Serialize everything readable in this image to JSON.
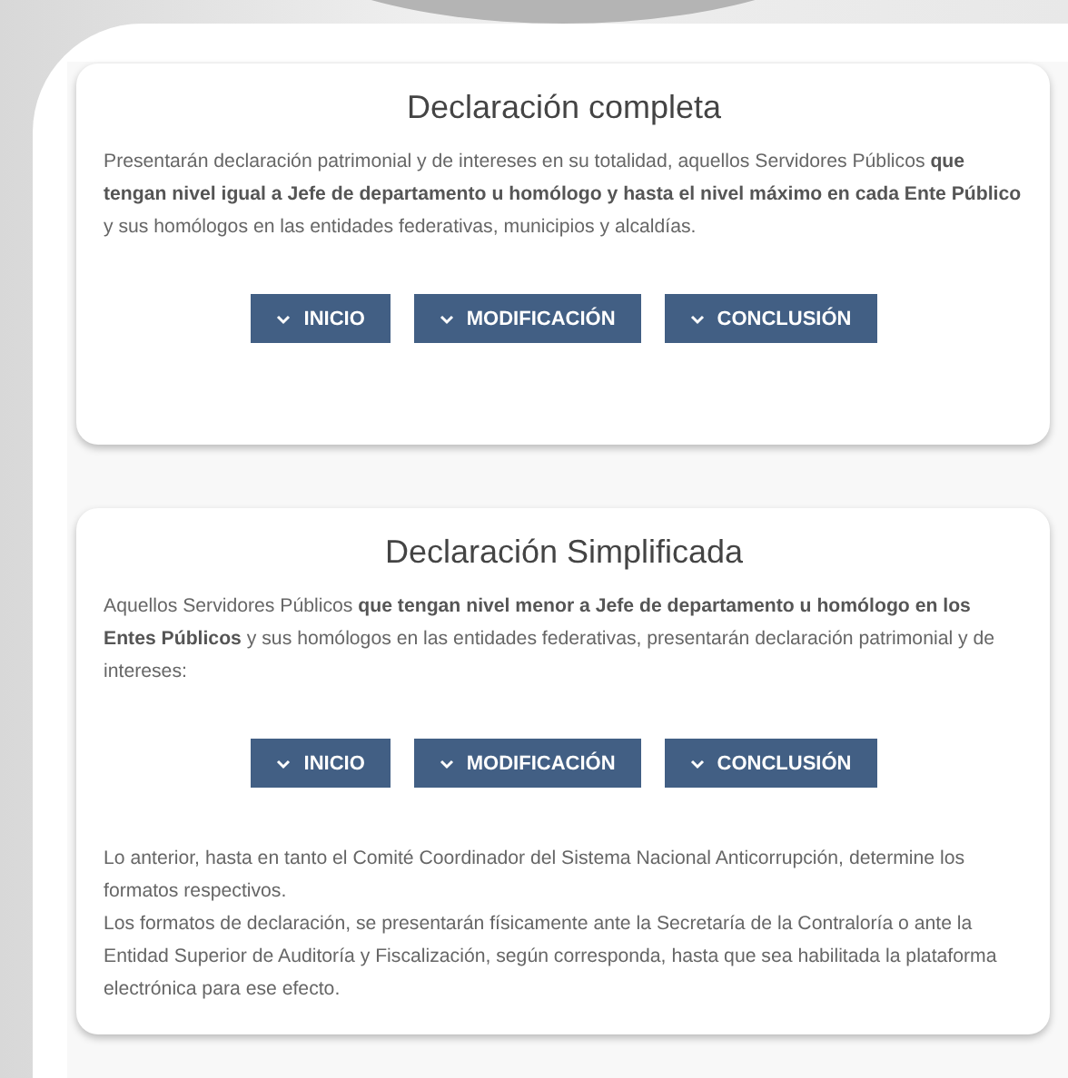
{
  "sections": [
    {
      "title": "Declaración completa",
      "paragraphs": [
        "Presentarán declaración patrimonial y de intereses en su totalidad, aquellos Servidores Públicos **que tengan nivel igual a Jefe de departamento u homólogo y hasta el nivel máximo en cada Ente Público** y sus homólogos en las entidades federativas, municipios y alcaldías."
      ],
      "buttons": [
        "INICIO",
        "MODIFICACIÓN",
        "CONCLUSIÓN"
      ]
    },
    {
      "title": "Declaración Simplificada",
      "paragraphs": [
        "Aquellos Servidores Públicos **que tengan nivel menor a Jefe de departamento u homólogo en los Entes Públicos** y sus homólogos en las entidades federativas, presentarán declaración patrimonial y de intereses:"
      ],
      "buttons": [
        "INICIO",
        "MODIFICACIÓN",
        "CONCLUSIÓN"
      ],
      "notes": [
        "Lo anterior, hasta en tanto el Comité Coordinador del Sistema Nacional Anticorrupción, determine los formatos respectivos.",
        "Los formatos de declaración, se presentarán físicamente ante la Secretaría de la Contraloría o ante la Entidad Superior de Auditoría y Fiscalización, según corresponda, hasta que sea habilitada la plataforma electrónica para ese efecto."
      ]
    }
  ]
}
